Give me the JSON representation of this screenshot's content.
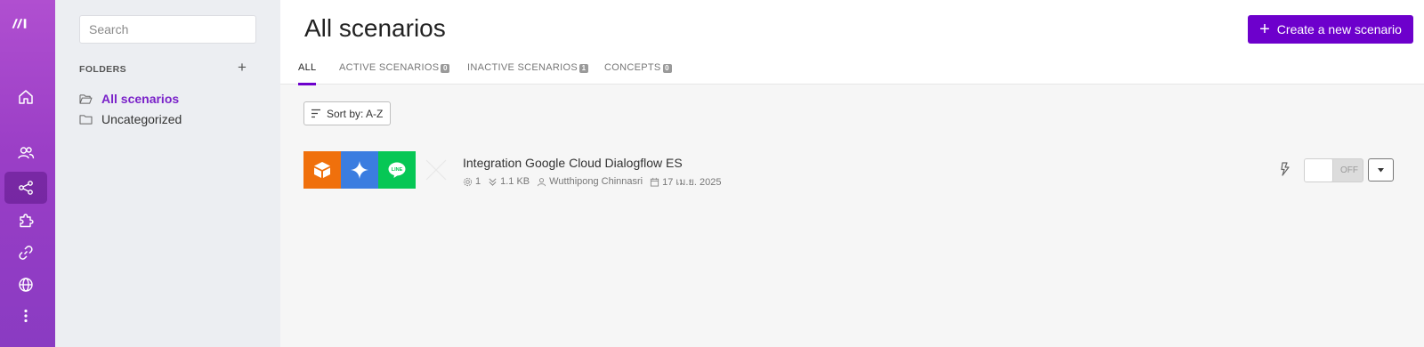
{
  "rail": {
    "logo_icon": "make-logo-icon",
    "items": [
      {
        "name": "home-icon"
      },
      {
        "name": "users-icon"
      },
      {
        "name": "share-scenarios-icon",
        "active": true
      },
      {
        "name": "puzzle-icon"
      },
      {
        "name": "link-icon"
      },
      {
        "name": "globe-icon"
      },
      {
        "name": "more-vertical-icon"
      }
    ]
  },
  "folders": {
    "search_placeholder": "Search",
    "heading": "FOLDERS",
    "add_label": "+",
    "items": [
      {
        "label": "All scenarios",
        "active": true,
        "icon": "folder-open-icon"
      },
      {
        "label": "Uncategorized",
        "active": false,
        "icon": "folder-icon"
      }
    ]
  },
  "main": {
    "title": "All scenarios",
    "create_button": "Create a new scenario",
    "tabs": [
      {
        "label": "ALL",
        "active": true
      },
      {
        "label": "ACTIVE SCENARIOS",
        "count": "0"
      },
      {
        "label": "INACTIVE SCENARIOS",
        "count": "1"
      },
      {
        "label": "CONCEPTS",
        "count": "0"
      }
    ],
    "sort_label": "Sort by: A-Z",
    "scenario": {
      "name": "Integration Google Cloud Dialogflow ES",
      "operations": "1",
      "size": "1.1 KB",
      "author": "Wutthipong Chinnasri",
      "date": "17 เม.ย. 2025",
      "apps": [
        {
          "name": "box-app-icon",
          "color": "#f0700c"
        },
        {
          "name": "sparkle-app-icon",
          "color": "#3b7de0"
        },
        {
          "name": "line-app-icon",
          "color": "#06c755"
        }
      ],
      "toggle_label": "OFF"
    }
  },
  "colors": {
    "accent": "#6d00cc",
    "rail_top": "#b04fd0",
    "rail_bottom": "#8a3bc2"
  }
}
